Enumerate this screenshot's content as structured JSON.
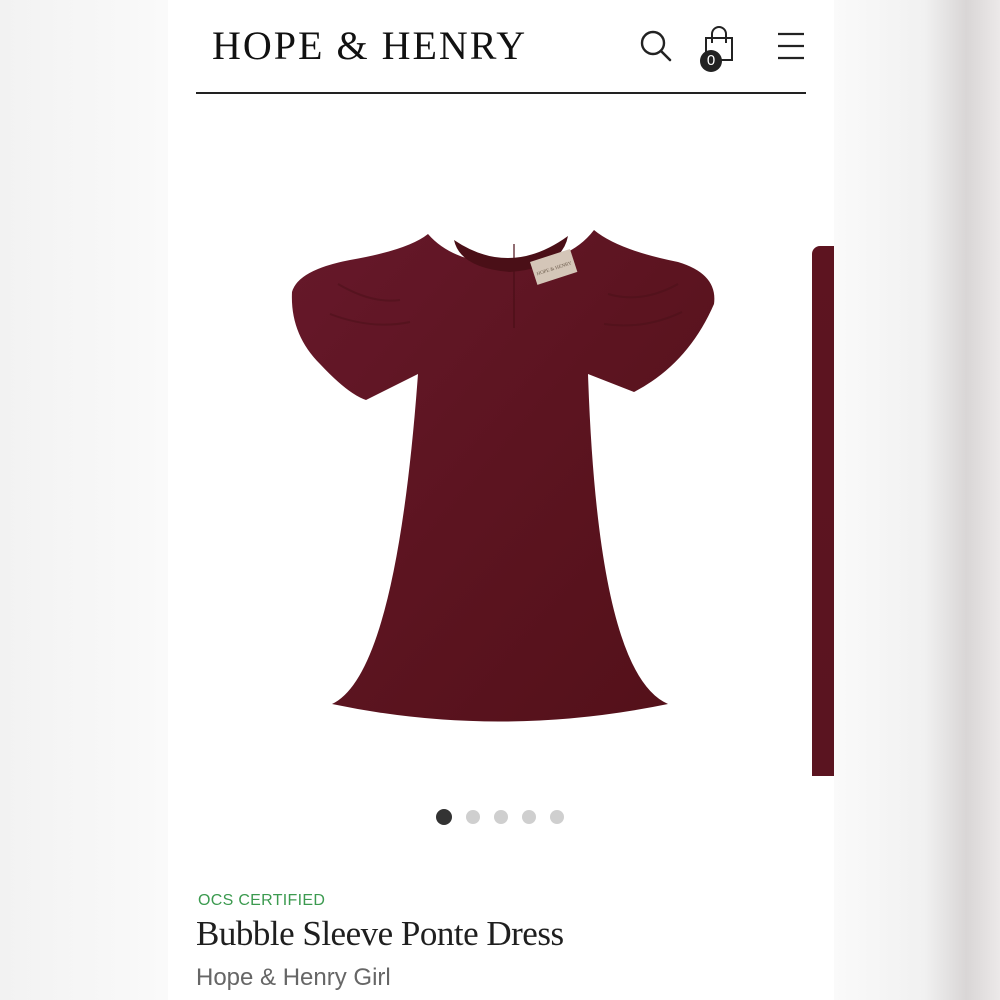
{
  "header": {
    "logo": "HOPE & HENRY",
    "icons": {
      "search": "search-icon",
      "bag": "shopping-bag-icon",
      "menu": "hamburger-menu-icon"
    },
    "cart_count": "0"
  },
  "carousel": {
    "dots": [
      "slide-1",
      "slide-2",
      "slide-3",
      "slide-4",
      "slide-5"
    ],
    "active_index": 0,
    "dress_color": "#5c1420",
    "label_text": "HOPE & HENRY"
  },
  "product": {
    "badge": "OCS CERTIFIED",
    "badge_color": "#3b9a4f",
    "title": "Bubble Sleeve Ponte Dress",
    "brand_line": "Hope & Henry Girl"
  }
}
